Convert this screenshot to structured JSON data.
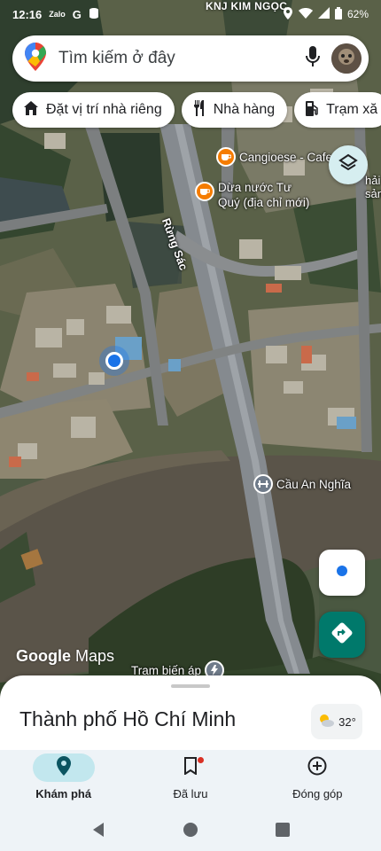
{
  "status_bar": {
    "time": "12:16",
    "notif_1": "Zalo",
    "notif_2": "G",
    "battery": "62%"
  },
  "map": {
    "top_partial_label": "KNJ KIM NGỌC",
    "road_label": "Rừng Sác",
    "pois": [
      {
        "label": "Cangioese - Cafe & b",
        "icon": "cafe-icon"
      },
      {
        "label": "Dừa nước Tư\nQuý (địa chỉ mới)",
        "icon": "cafe-icon"
      },
      {
        "label": "Cầu An Nghĩa",
        "icon": "bridge-icon"
      },
      {
        "label": "Trạm biến áp",
        "icon": "power-station-icon"
      }
    ],
    "partial_text_right": "hải sản",
    "logo_google": "Google",
    "logo_maps": "Maps"
  },
  "search": {
    "placeholder": "Tìm kiếm ở đây"
  },
  "chips": [
    {
      "label": "Đặt vị trí nhà riêng",
      "icon": "home-icon"
    },
    {
      "label": "Nhà hàng",
      "icon": "restaurant-icon"
    },
    {
      "label": "Trạm xă",
      "icon": "gas-station-icon"
    }
  ],
  "sheet": {
    "title": "Thành phố Hồ Chí Minh",
    "temperature": "32°"
  },
  "nav": {
    "tabs": [
      {
        "label": "Khám phá",
        "icon": "location-pin-icon",
        "active": true
      },
      {
        "label": "Đã lưu",
        "icon": "bookmark-icon",
        "active": false
      },
      {
        "label": "Đóng góp",
        "icon": "add-circle-icon",
        "active": false
      }
    ]
  },
  "colors": {
    "accent": "#00796b",
    "active_tab": "#c2e7ee",
    "poi_orange": "#f57c00",
    "my_location": "#1a73e8"
  }
}
